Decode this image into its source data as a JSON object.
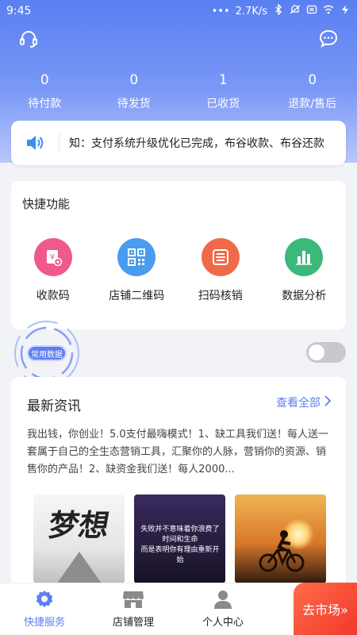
{
  "status_bar": {
    "time": "9:45",
    "speed": "2.7K/s"
  },
  "header": {
    "left_icon": "headset-icon",
    "right_icon": "chat-icon"
  },
  "orders": [
    {
      "count": "0",
      "label": "待付款"
    },
    {
      "count": "0",
      "label": "待发货"
    },
    {
      "count": "1",
      "label": "已收货"
    },
    {
      "count": "0",
      "label": "退款/售后"
    }
  ],
  "notice": {
    "text": "知：支付系统升级优化已完成，布谷收款、布谷还款"
  },
  "quick": {
    "title": "快捷功能",
    "items": [
      {
        "label": "收款码",
        "icon": "receive-money-icon",
        "color": "#f05a8a"
      },
      {
        "label": "店铺二维码",
        "icon": "qr-code-icon",
        "color": "#4a9cf0"
      },
      {
        "label": "扫码核销",
        "icon": "scan-icon",
        "color": "#f06a4a"
      },
      {
        "label": "数据分析",
        "icon": "bar-chart-icon",
        "color": "#3bb87a"
      }
    ]
  },
  "float_badge": {
    "label": "常用数据"
  },
  "news": {
    "title": "最新资讯",
    "more": "查看全部",
    "body": "我出钱，你创业！5.0支付最嗨模式！1、缺工具我们送！每人送一套属于自己的全生态营销工具，汇聚你的人脉，营销你的资源、销售你的产品！2、缺资金我们送！每人2000...",
    "thumb1_text": "梦想",
    "thumb2_text": "失败并不意味着你浪费了时间和生命\n而是表明你有理由重新开始"
  },
  "tabbar": {
    "tabs": [
      {
        "label": "快捷服务",
        "icon": "gear-icon"
      },
      {
        "label": "店铺管理",
        "icon": "store-icon"
      },
      {
        "label": "个人中心",
        "icon": "user-icon"
      }
    ],
    "market": "去市场»"
  },
  "colors": {
    "accent": "#5d7ef0",
    "market": "#f2392c"
  }
}
